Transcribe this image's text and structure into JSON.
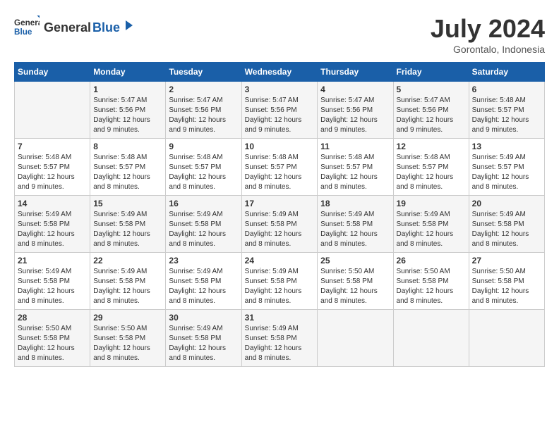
{
  "header": {
    "logo_general": "General",
    "logo_blue": "Blue",
    "month_title": "July 2024",
    "location": "Gorontalo, Indonesia"
  },
  "days_of_week": [
    "Sunday",
    "Monday",
    "Tuesday",
    "Wednesday",
    "Thursday",
    "Friday",
    "Saturday"
  ],
  "weeks": [
    [
      {
        "day": "",
        "info": ""
      },
      {
        "day": "1",
        "info": "Sunrise: 5:47 AM\nSunset: 5:56 PM\nDaylight: 12 hours and 9 minutes."
      },
      {
        "day": "2",
        "info": "Sunrise: 5:47 AM\nSunset: 5:56 PM\nDaylight: 12 hours and 9 minutes."
      },
      {
        "day": "3",
        "info": "Sunrise: 5:47 AM\nSunset: 5:56 PM\nDaylight: 12 hours and 9 minutes."
      },
      {
        "day": "4",
        "info": "Sunrise: 5:47 AM\nSunset: 5:56 PM\nDaylight: 12 hours and 9 minutes."
      },
      {
        "day": "5",
        "info": "Sunrise: 5:47 AM\nSunset: 5:56 PM\nDaylight: 12 hours and 9 minutes."
      },
      {
        "day": "6",
        "info": "Sunrise: 5:48 AM\nSunset: 5:57 PM\nDaylight: 12 hours and 9 minutes."
      }
    ],
    [
      {
        "day": "7",
        "info": "Sunrise: 5:48 AM\nSunset: 5:57 PM\nDaylight: 12 hours and 9 minutes."
      },
      {
        "day": "8",
        "info": "Sunrise: 5:48 AM\nSunset: 5:57 PM\nDaylight: 12 hours and 8 minutes."
      },
      {
        "day": "9",
        "info": "Sunrise: 5:48 AM\nSunset: 5:57 PM\nDaylight: 12 hours and 8 minutes."
      },
      {
        "day": "10",
        "info": "Sunrise: 5:48 AM\nSunset: 5:57 PM\nDaylight: 12 hours and 8 minutes."
      },
      {
        "day": "11",
        "info": "Sunrise: 5:48 AM\nSunset: 5:57 PM\nDaylight: 12 hours and 8 minutes."
      },
      {
        "day": "12",
        "info": "Sunrise: 5:48 AM\nSunset: 5:57 PM\nDaylight: 12 hours and 8 minutes."
      },
      {
        "day": "13",
        "info": "Sunrise: 5:49 AM\nSunset: 5:57 PM\nDaylight: 12 hours and 8 minutes."
      }
    ],
    [
      {
        "day": "14",
        "info": "Sunrise: 5:49 AM\nSunset: 5:58 PM\nDaylight: 12 hours and 8 minutes."
      },
      {
        "day": "15",
        "info": "Sunrise: 5:49 AM\nSunset: 5:58 PM\nDaylight: 12 hours and 8 minutes."
      },
      {
        "day": "16",
        "info": "Sunrise: 5:49 AM\nSunset: 5:58 PM\nDaylight: 12 hours and 8 minutes."
      },
      {
        "day": "17",
        "info": "Sunrise: 5:49 AM\nSunset: 5:58 PM\nDaylight: 12 hours and 8 minutes."
      },
      {
        "day": "18",
        "info": "Sunrise: 5:49 AM\nSunset: 5:58 PM\nDaylight: 12 hours and 8 minutes."
      },
      {
        "day": "19",
        "info": "Sunrise: 5:49 AM\nSunset: 5:58 PM\nDaylight: 12 hours and 8 minutes."
      },
      {
        "day": "20",
        "info": "Sunrise: 5:49 AM\nSunset: 5:58 PM\nDaylight: 12 hours and 8 minutes."
      }
    ],
    [
      {
        "day": "21",
        "info": "Sunrise: 5:49 AM\nSunset: 5:58 PM\nDaylight: 12 hours and 8 minutes."
      },
      {
        "day": "22",
        "info": "Sunrise: 5:49 AM\nSunset: 5:58 PM\nDaylight: 12 hours and 8 minutes."
      },
      {
        "day": "23",
        "info": "Sunrise: 5:49 AM\nSunset: 5:58 PM\nDaylight: 12 hours and 8 minutes."
      },
      {
        "day": "24",
        "info": "Sunrise: 5:49 AM\nSunset: 5:58 PM\nDaylight: 12 hours and 8 minutes."
      },
      {
        "day": "25",
        "info": "Sunrise: 5:50 AM\nSunset: 5:58 PM\nDaylight: 12 hours and 8 minutes."
      },
      {
        "day": "26",
        "info": "Sunrise: 5:50 AM\nSunset: 5:58 PM\nDaylight: 12 hours and 8 minutes."
      },
      {
        "day": "27",
        "info": "Sunrise: 5:50 AM\nSunset: 5:58 PM\nDaylight: 12 hours and 8 minutes."
      }
    ],
    [
      {
        "day": "28",
        "info": "Sunrise: 5:50 AM\nSunset: 5:58 PM\nDaylight: 12 hours and 8 minutes."
      },
      {
        "day": "29",
        "info": "Sunrise: 5:50 AM\nSunset: 5:58 PM\nDaylight: 12 hours and 8 minutes."
      },
      {
        "day": "30",
        "info": "Sunrise: 5:49 AM\nSunset: 5:58 PM\nDaylight: 12 hours and 8 minutes."
      },
      {
        "day": "31",
        "info": "Sunrise: 5:49 AM\nSunset: 5:58 PM\nDaylight: 12 hours and 8 minutes."
      },
      {
        "day": "",
        "info": ""
      },
      {
        "day": "",
        "info": ""
      },
      {
        "day": "",
        "info": ""
      }
    ]
  ]
}
